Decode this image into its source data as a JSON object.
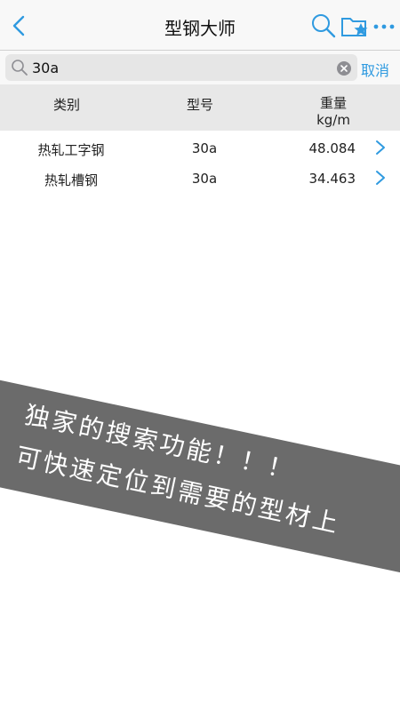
{
  "nav": {
    "title": "型钢大师",
    "icons": [
      "chevron-left-icon",
      "search-icon",
      "folder-star-icon",
      "more-icon"
    ]
  },
  "search": {
    "value": "30a",
    "cancel_label": "取消"
  },
  "table": {
    "headers": {
      "category": "类别",
      "model": "型号",
      "weight": "重量",
      "weight_unit": "kg/m"
    },
    "rows": [
      {
        "category": "热轧工字钢",
        "model": "30a",
        "weight": "48.084"
      },
      {
        "category": "热轧槽钢",
        "model": "30a",
        "weight": "34.463"
      }
    ]
  },
  "banner": {
    "line1": "独家的搜索功能！！！",
    "line2": "可快速定位到需要的型材上"
  },
  "colors": {
    "accent": "#2f9ae0",
    "banner_bg": "#6b6b6b",
    "header_bg": "#e8e8e8"
  }
}
